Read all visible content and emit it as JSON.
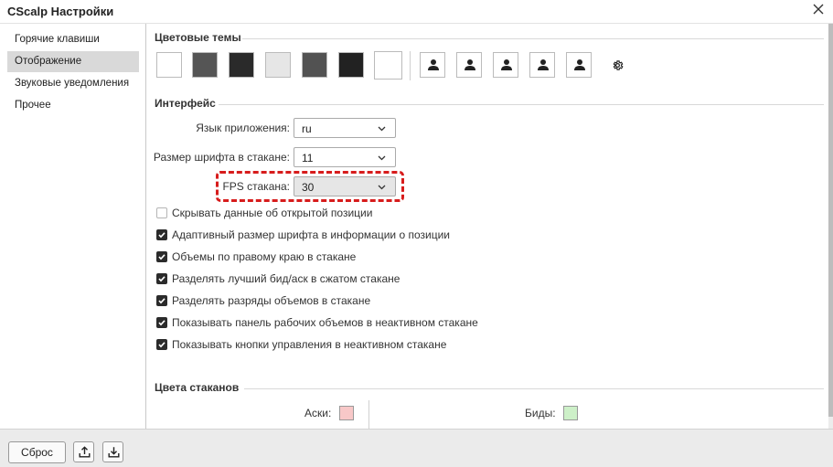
{
  "window": {
    "title": "CScalp Настройки"
  },
  "sidebar": {
    "items": [
      {
        "label": "Горячие клавиши",
        "active": false
      },
      {
        "label": "Отображение",
        "active": true
      },
      {
        "label": "Звуковые уведомления",
        "active": false
      },
      {
        "label": "Прочее",
        "active": false
      }
    ]
  },
  "themes": {
    "title": "Цветовые темы",
    "swatches": [
      {
        "color": "#ffffff",
        "selected": false
      },
      {
        "color": "#555555",
        "selected": false
      },
      {
        "color": "#2a2a2a",
        "selected": false
      },
      {
        "color": "#e6e6e6",
        "selected": false
      },
      {
        "color": "#525252",
        "selected": false
      },
      {
        "color": "#222222",
        "selected": false
      },
      {
        "color": "#ffffff",
        "selected": true
      }
    ],
    "user_theme_icons": [
      "user-icon",
      "user-icon",
      "user-icon",
      "user-icon",
      "user-icon"
    ],
    "settings_icon": "gear-icon"
  },
  "interface": {
    "title": "Интерфейс",
    "language": {
      "label": "Язык приложения:",
      "value": "ru"
    },
    "font_size": {
      "label": "Размер шрифта в стакане:",
      "value": "11"
    },
    "fps": {
      "label": "FPS стакана:",
      "value": "30"
    },
    "checkboxes": [
      {
        "label": "Скрывать данные об открытой позиции",
        "checked": false
      },
      {
        "label": "Адаптивный размер шрифта в информации о позиции",
        "checked": true
      },
      {
        "label": "Объемы по правому краю в стакане",
        "checked": true
      },
      {
        "label": "Разделять лучший бид/аск в сжатом стакане",
        "checked": true
      },
      {
        "label": "Разделять разряды объемов в стакане",
        "checked": true
      },
      {
        "label": "Показывать панель рабочих объемов в неактивном стакане",
        "checked": true
      },
      {
        "label": "Показывать кнопки управления в неактивном стакане",
        "checked": true
      }
    ]
  },
  "book_colors": {
    "title": "Цвета стаканов",
    "asks": {
      "label": "Аски:",
      "color": "#f8c8c8"
    },
    "bids": {
      "label": "Биды:",
      "color": "#cdf0c8"
    }
  },
  "footer": {
    "reset_label": "Сброс",
    "export_icon": "upload-icon",
    "import_icon": "download-icon"
  }
}
